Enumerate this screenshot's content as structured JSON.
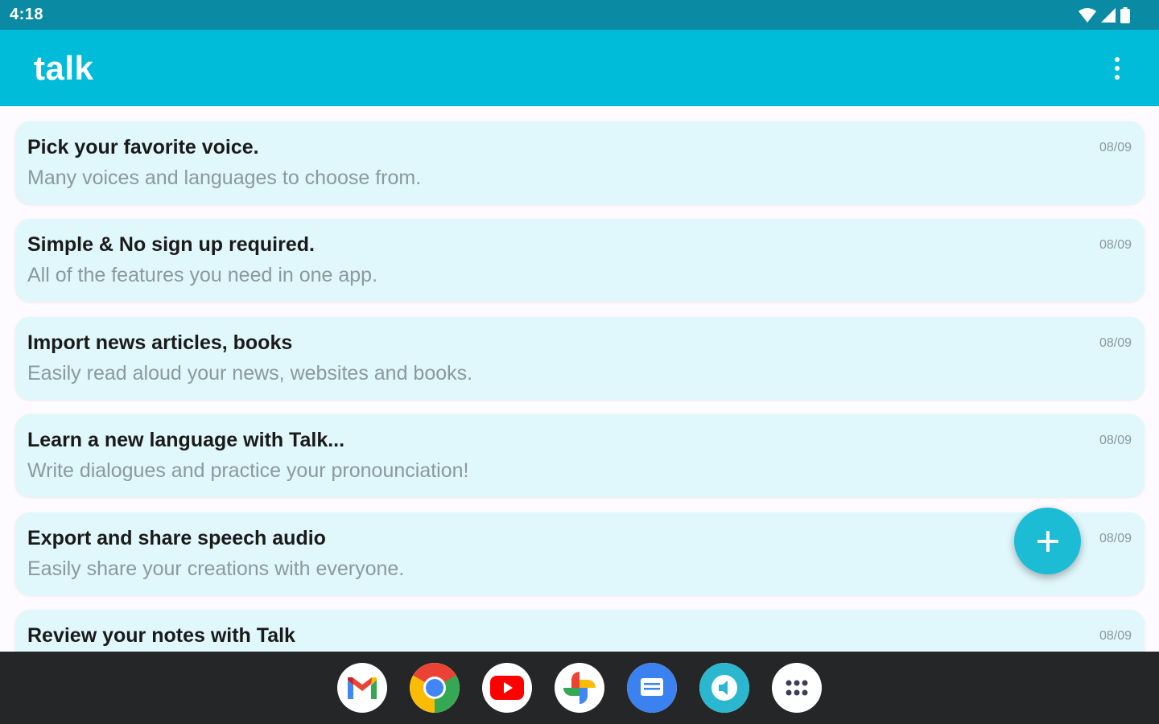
{
  "status_bar": {
    "time": "4:18"
  },
  "app_bar": {
    "title": "talk",
    "overflow_icon": "more-vert-icon"
  },
  "notes": [
    {
      "title": "Pick your favorite voice.",
      "subtitle": "Many voices and languages to choose from.",
      "date": "08/09"
    },
    {
      "title": "Simple & No sign up required.",
      "subtitle": "All of the features you need in one app.",
      "date": "08/09"
    },
    {
      "title": "Import news articles, books",
      "subtitle": "Easily read aloud your news, websites and books.",
      "date": "08/09"
    },
    {
      "title": "Learn a new language with Talk...",
      "subtitle": "Write dialogues and practice your pronounciation!",
      "date": "08/09"
    },
    {
      "title": "Export and share speech audio",
      "subtitle": "Easily share your creations with everyone.",
      "date": "08/09"
    },
    {
      "title": "Review your notes with Talk",
      "subtitle": "",
      "date": "08/09"
    }
  ],
  "fab": {
    "icon": "plus-icon"
  },
  "dock": [
    "gmail-icon",
    "chrome-icon",
    "youtube-icon",
    "photos-icon",
    "messages-icon",
    "talk-app-icon",
    "app-drawer-icon"
  ],
  "colors": {
    "status_bar": "#0a8aa3",
    "app_bar": "#00bcd9",
    "card": "#e0f7fb",
    "fab": "#1cbcd4",
    "taskbar": "#252627"
  }
}
